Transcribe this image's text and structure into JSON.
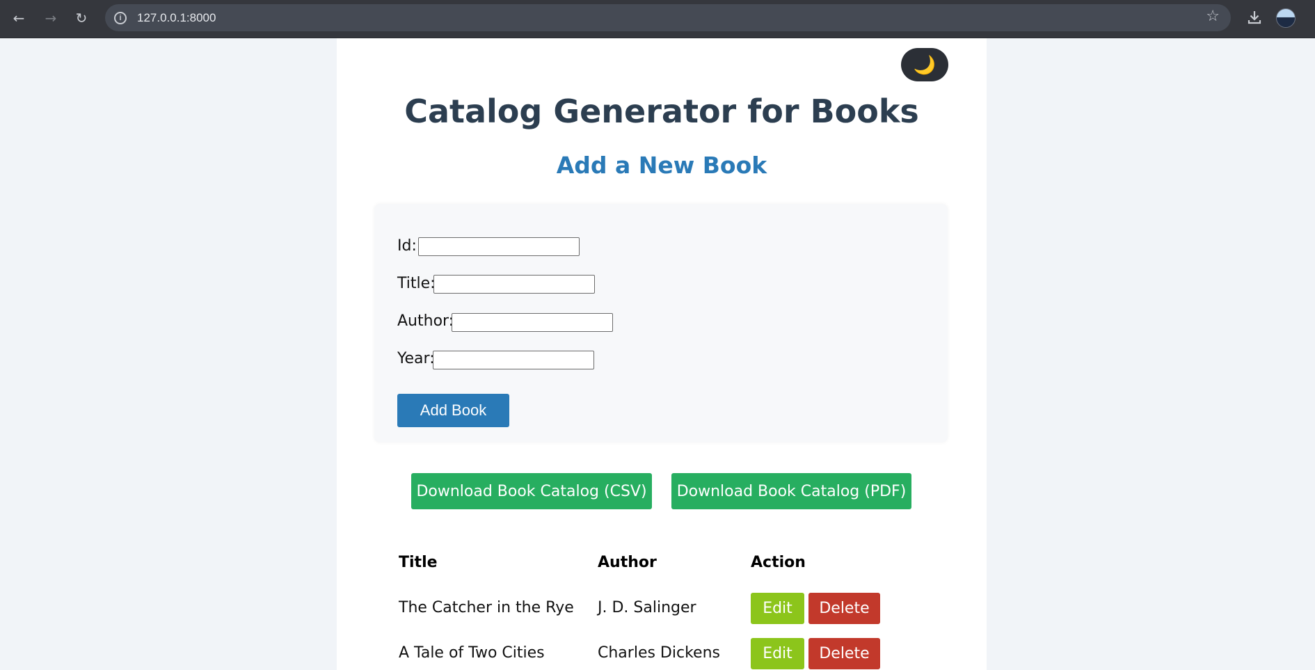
{
  "browser": {
    "back_icon": "arrow-left-icon",
    "forward_icon": "arrow-right-icon",
    "reload_icon": "reload-icon",
    "url": "127.0.0.1:8000",
    "bookmark_icon": "star-icon",
    "download_icon": "download-icon"
  },
  "theme_toggle": {
    "icon": "moon-icon",
    "glyph": "🌙"
  },
  "header": {
    "title": "Catalog Generator for Books",
    "subtitle": "Add a New Book"
  },
  "form": {
    "fields": [
      {
        "label": "Id:",
        "value": ""
      },
      {
        "label": "Title:",
        "value": ""
      },
      {
        "label": "Author:",
        "value": ""
      },
      {
        "label": "Year:",
        "value": ""
      }
    ],
    "submit_label": "Add Book"
  },
  "downloads": {
    "csv_label": "Download Book Catalog (CSV)",
    "pdf_label": "Download Book Catalog (PDF)"
  },
  "table": {
    "headers": [
      "Title",
      "Author",
      "Action"
    ],
    "rows": [
      {
        "title": "The Catcher in the Rye",
        "author": "J. D. Salinger",
        "edit": "Edit",
        "delete": "Delete"
      },
      {
        "title": "A Tale of Two Cities",
        "author": "Charles Dickens",
        "edit": "Edit",
        "delete": "Delete"
      }
    ]
  },
  "colors": {
    "primary": "#2a7ab7",
    "heading": "#2c3e50",
    "download": "#27ae60",
    "edit": "#8cc51b",
    "delete": "#c2392b",
    "page_bg": "#f1f4f8"
  }
}
